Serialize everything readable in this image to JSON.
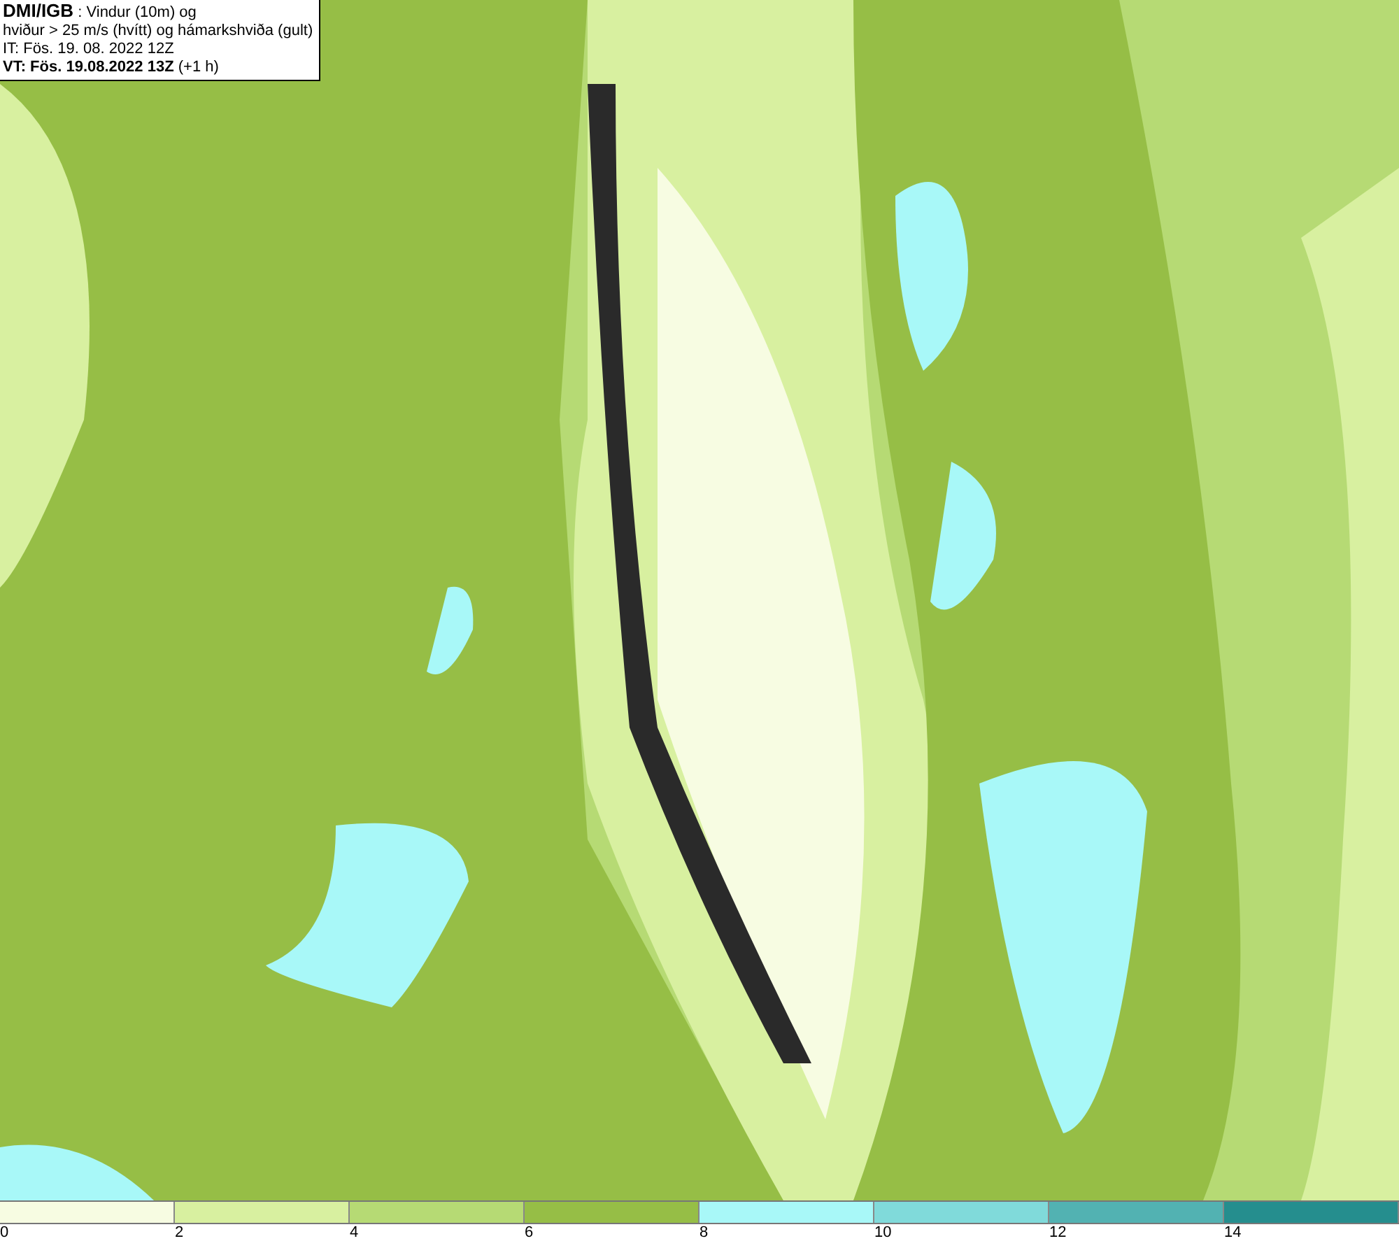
{
  "info_box": {
    "lines": [
      "**DMI/IGB** : Vindur (10m) og",
      "hviður > 25 m/s (hvítt) og hámarkshviða (gult)",
      "IT: Fös. 19. 08. 2022 12Z",
      "**VT: Fös. 19.08.2022 13Z** (+1 h)"
    ]
  },
  "legend": {
    "bins": [
      {
        "label": "0",
        "color": "#f7fce2"
      },
      {
        "label": "2",
        "color": "#d8f0a0"
      },
      {
        "label": "4",
        "color": "#b6da74"
      },
      {
        "label": "6",
        "color": "#96be46"
      },
      {
        "label": "8",
        "color": "#a8f8f8"
      },
      {
        "label": "10",
        "color": "#80dada"
      },
      {
        "label": "12",
        "color": "#52b2b2"
      },
      {
        "label": "14",
        "color": "#258e8e"
      }
    ]
  }
}
